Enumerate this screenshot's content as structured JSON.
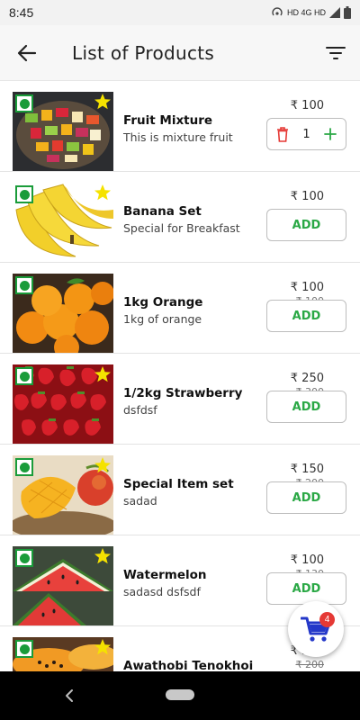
{
  "status_bar": {
    "time": "8:45",
    "network": "HD 4G HD"
  },
  "app_bar": {
    "title": "List of Products",
    "back_icon": "arrow-left-icon",
    "filter_icon": "filter-icon"
  },
  "colors": {
    "accent_green": "#2aa845",
    "veg_green": "#1a9c3a",
    "delete_red": "#e53935",
    "star_yellow": "#f5e200",
    "cart_blue": "#2438c9"
  },
  "products": [
    {
      "name": "Fruit Mixture",
      "desc": "This is mixture fruit",
      "price": "₹ 100",
      "mrp": "",
      "starred": true,
      "in_cart": true,
      "qty": "1",
      "image": "fruit-mix"
    },
    {
      "name": "Banana Set",
      "desc": "Special for Breakfast",
      "price": "₹ 100",
      "mrp": "",
      "starred": true,
      "in_cart": false,
      "action": "ADD",
      "image": "banana"
    },
    {
      "name": "1kg Orange",
      "desc": "1kg of orange",
      "price": "₹ 100",
      "mrp": "₹ 100",
      "starred": false,
      "in_cart": false,
      "action": "ADD",
      "image": "orange"
    },
    {
      "name": "1/2kg Strawberry",
      "desc": "dsfdsf",
      "price": "₹ 250",
      "mrp": "₹ 300",
      "starred": true,
      "in_cart": false,
      "action": "ADD",
      "image": "strawberry"
    },
    {
      "name": "Special Item set",
      "desc": "sadad",
      "price": "₹ 150",
      "mrp": "₹ 200",
      "starred": true,
      "in_cart": false,
      "action": "ADD",
      "image": "mango"
    },
    {
      "name": "Watermelon",
      "desc": "sadasd dsfsdf",
      "price": "₹ 100",
      "mrp": "₹ 130",
      "starred": true,
      "in_cart": false,
      "action": "ADD",
      "image": "watermelon"
    },
    {
      "name": "Awathobi Tenokhoi",
      "desc": "",
      "price": "₹ 250",
      "mrp": "₹ 200",
      "starred": true,
      "in_cart": false,
      "action": "ADD",
      "image": "papaya"
    }
  ],
  "cart": {
    "count": "4",
    "icon": "shopping-cart-icon"
  }
}
